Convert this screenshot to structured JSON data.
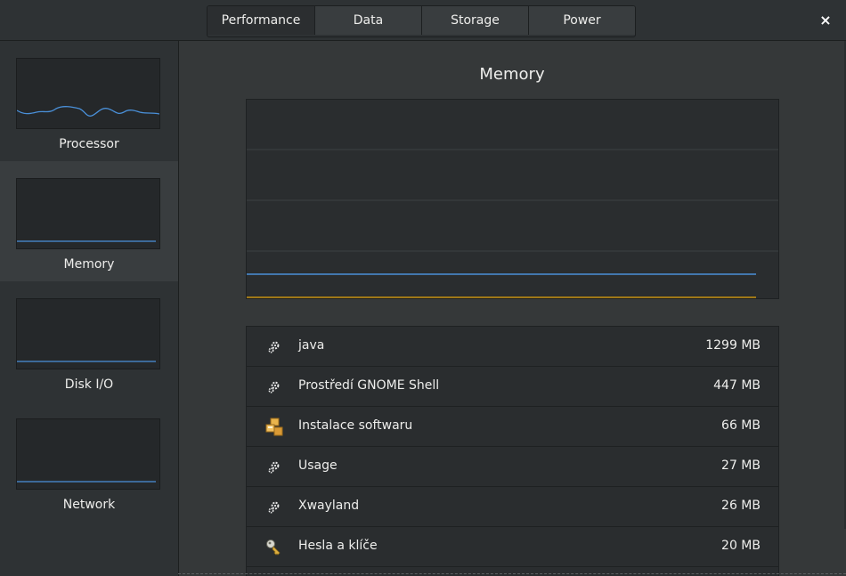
{
  "tabs": [
    {
      "label": "Performance"
    },
    {
      "label": "Data"
    },
    {
      "label": "Storage"
    },
    {
      "label": "Power"
    }
  ],
  "close_label": "×",
  "sidebar": {
    "items": [
      {
        "label": "Processor"
      },
      {
        "label": "Memory"
      },
      {
        "label": "Disk I/O"
      },
      {
        "label": "Network"
      }
    ],
    "selected": "Memory"
  },
  "main": {
    "title": "Memory"
  },
  "processes": [
    {
      "name": "java",
      "size": "1299 MB",
      "icon": "gear-icon"
    },
    {
      "name": "Prostředí GNOME Shell",
      "size": "447 MB",
      "icon": "gear-icon"
    },
    {
      "name": "Instalace softwaru",
      "size": "66 MB",
      "icon": "software-install-icon"
    },
    {
      "name": "Usage",
      "size": "27 MB",
      "icon": "gear-icon"
    },
    {
      "name": "Xwayland",
      "size": "26 MB",
      "icon": "gear-icon"
    },
    {
      "name": "Hesla a klíče",
      "size": "20 MB",
      "icon": "keys-icon"
    }
  ],
  "colors": {
    "graph_line_blue": "#4a90d9",
    "graph_line_orange": "#e5a50a",
    "background": "#353839"
  }
}
